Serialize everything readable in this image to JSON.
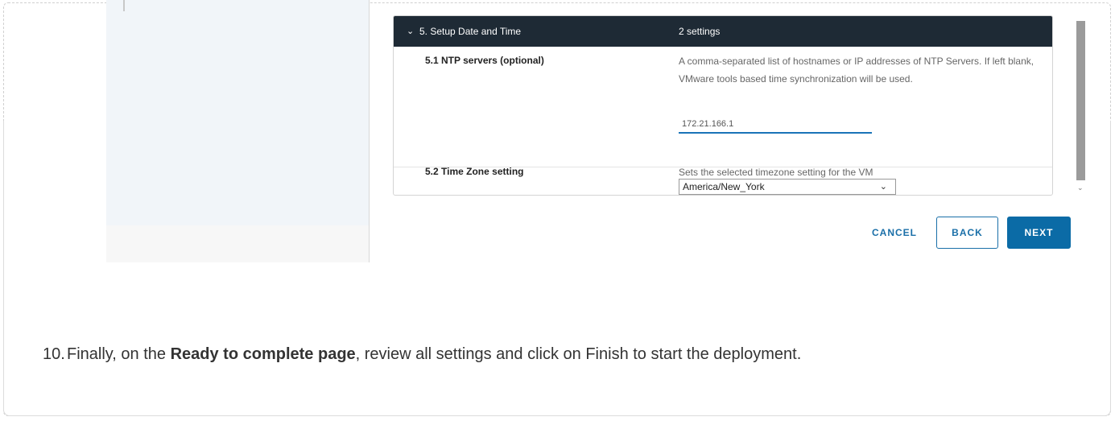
{
  "section": {
    "expand_glyph": "⌄",
    "title": "5. Setup Date and Time",
    "count": "2 settings"
  },
  "ntp": {
    "label": "5.1 NTP servers (optional)",
    "description": "A comma-separated list of hostnames or IP addresses of NTP Servers. If left blank, VMware tools based time synchronization will be used.",
    "value": "172.21.166.1"
  },
  "timezone": {
    "label": "5.2 Time Zone setting",
    "description": "Sets the selected timezone setting for the VM",
    "selected": "America/New_York"
  },
  "buttons": {
    "cancel": "CANCEL",
    "back": "BACK",
    "next": "NEXT"
  },
  "instruction": {
    "number": "10.",
    "prefix": "Finally, on the ",
    "bold": "Ready to complete page",
    "suffix": ", review all settings and click on Finish to start the deployment."
  },
  "colors": {
    "header_bg": "#1e2a35",
    "accent": "#0b6ba6"
  },
  "icons": {
    "section_toggle": "chevron-down-icon",
    "select_arrow": "chevron-down-icon",
    "scroll_down": "scroll-down-icon"
  }
}
